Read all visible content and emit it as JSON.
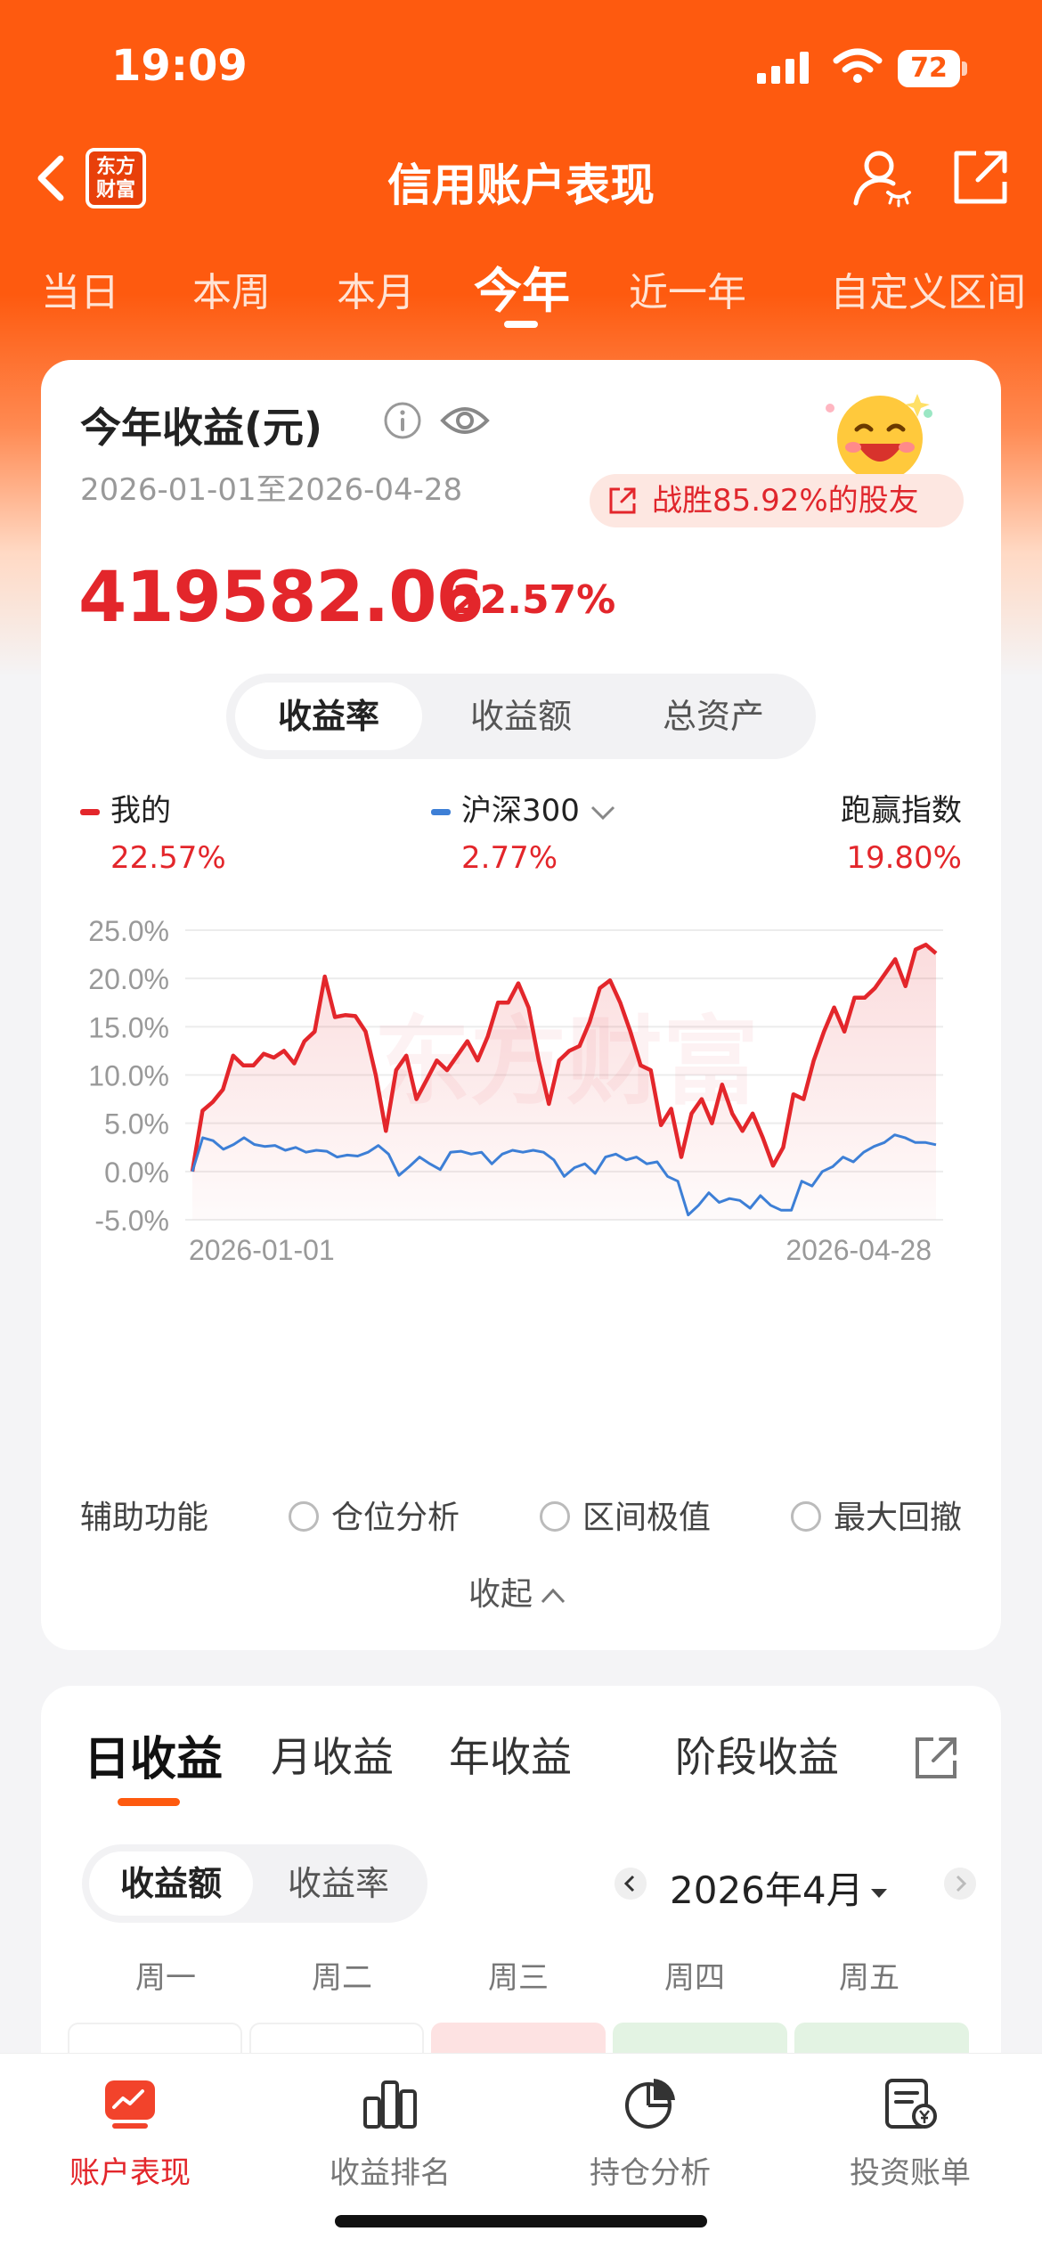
{
  "status_bar": {
    "time": "19:09",
    "battery": "72"
  },
  "header": {
    "title": "信用账户表现",
    "logo_text": [
      "东方",
      "财富"
    ]
  },
  "period_tabs": [
    {
      "label": "当日",
      "active": false
    },
    {
      "label": "本周",
      "active": false
    },
    {
      "label": "本月",
      "active": false
    },
    {
      "label": "今年",
      "active": true
    },
    {
      "label": "近一年",
      "active": false
    },
    {
      "label": "自定义区间",
      "active": false
    }
  ],
  "summary": {
    "title": "今年收益(元)",
    "date_range": "2026-01-01至2026-04-28",
    "beat_text": "战胜85.92%的股友",
    "profit_amount": "419582.06",
    "profit_pct": "22.57%"
  },
  "metric_toggle": [
    "收益率",
    "收益额",
    "总资产"
  ],
  "legend": {
    "mine": {
      "name": "我的",
      "value": "22.57%",
      "color": "#e3262b"
    },
    "index": {
      "name": "沪深300",
      "value": "2.77%",
      "color": "#3d7fd6"
    },
    "beat": {
      "name": "跑赢指数",
      "value": "19.80%"
    }
  },
  "chart_data": {
    "type": "line",
    "x_start_label": "2026-01-01",
    "x_end_label": "2026-04-28",
    "y_ticks": [
      "25.0%",
      "20.0%",
      "15.0%",
      "10.0%",
      "5.0%",
      "0.0%",
      "-5.0%"
    ],
    "ylim": [
      -5,
      25
    ],
    "watermark": "东方财富",
    "series": [
      {
        "name": "我的",
        "color": "#e3262b",
        "values": [
          0.0,
          6.3,
          7.2,
          8.5,
          12.0,
          11.0,
          11.0,
          12.2,
          11.8,
          12.5,
          11.2,
          13.5,
          14.5,
          20.2,
          16.0,
          16.2,
          16.1,
          14.5,
          10.0,
          4.2,
          10.5,
          12.0,
          7.5,
          9.5,
          11.5,
          10.5,
          12.0,
          13.5,
          11.5,
          14.0,
          17.5,
          17.5,
          19.5,
          17.0,
          11.5,
          7.0,
          11.5,
          12.5,
          13.0,
          15.5,
          19.0,
          19.8,
          17.5,
          14.5,
          11.0,
          10.5,
          4.8,
          6.5,
          1.5,
          6.0,
          7.5,
          5.0,
          9.0,
          6.0,
          4.2,
          6.0,
          3.5,
          0.6,
          2.5,
          8.0,
          7.5,
          11.5,
          14.5,
          17.0,
          14.5,
          18.0,
          18.0,
          19.0,
          20.5,
          22.0,
          19.2,
          23.0,
          23.5,
          22.6
        ]
      },
      {
        "name": "沪深300",
        "color": "#3d7fd6",
        "values": [
          0.0,
          3.5,
          3.2,
          2.3,
          2.8,
          3.5,
          2.8,
          2.6,
          2.7,
          2.2,
          2.5,
          2.0,
          2.2,
          2.1,
          1.5,
          1.7,
          1.6,
          2.0,
          2.7,
          1.8,
          -0.4,
          0.5,
          1.5,
          0.8,
          0.2,
          2.0,
          2.1,
          1.8,
          2.0,
          0.8,
          1.8,
          2.2,
          2.0,
          2.2,
          2.0,
          1.2,
          -0.5,
          0.4,
          0.8,
          -0.2,
          1.5,
          1.8,
          1.2,
          1.5,
          0.8,
          1.0,
          -0.5,
          -1.0,
          -4.5,
          -3.5,
          -2.2,
          -3.2,
          -2.8,
          -3.0,
          -3.8,
          -2.5,
          -3.5,
          -4.0,
          -4.0,
          -1.0,
          -1.5,
          0.0,
          0.5,
          1.5,
          1.0,
          2.0,
          2.6,
          3.0,
          3.8,
          3.5,
          3.0,
          3.0,
          2.77
        ]
      }
    ]
  },
  "assist": {
    "label": "辅助功能",
    "options": [
      "仓位分析",
      "区间极值",
      "最大回撤"
    ],
    "collapse": "收起"
  },
  "daily": {
    "tabs": [
      "日收益",
      "月收益",
      "年收益",
      "阶段收益"
    ],
    "toggle": [
      "收益额",
      "收益率"
    ],
    "month": "2026年4月",
    "weekdays": [
      "周一",
      "周二",
      "周三",
      "周四",
      "周五"
    ]
  },
  "bottom_nav": [
    {
      "label": "账户表现",
      "icon": "account-performance-icon",
      "active": true
    },
    {
      "label": "收益排名",
      "icon": "ranking-icon",
      "active": false
    },
    {
      "label": "持仓分析",
      "icon": "pie-chart-icon",
      "active": false
    },
    {
      "label": "投资账单",
      "icon": "bill-icon",
      "active": false
    }
  ],
  "colors": {
    "brand": "#fe5a0f",
    "up_red": "#e3262b",
    "index_blue": "#3d7fd6"
  }
}
